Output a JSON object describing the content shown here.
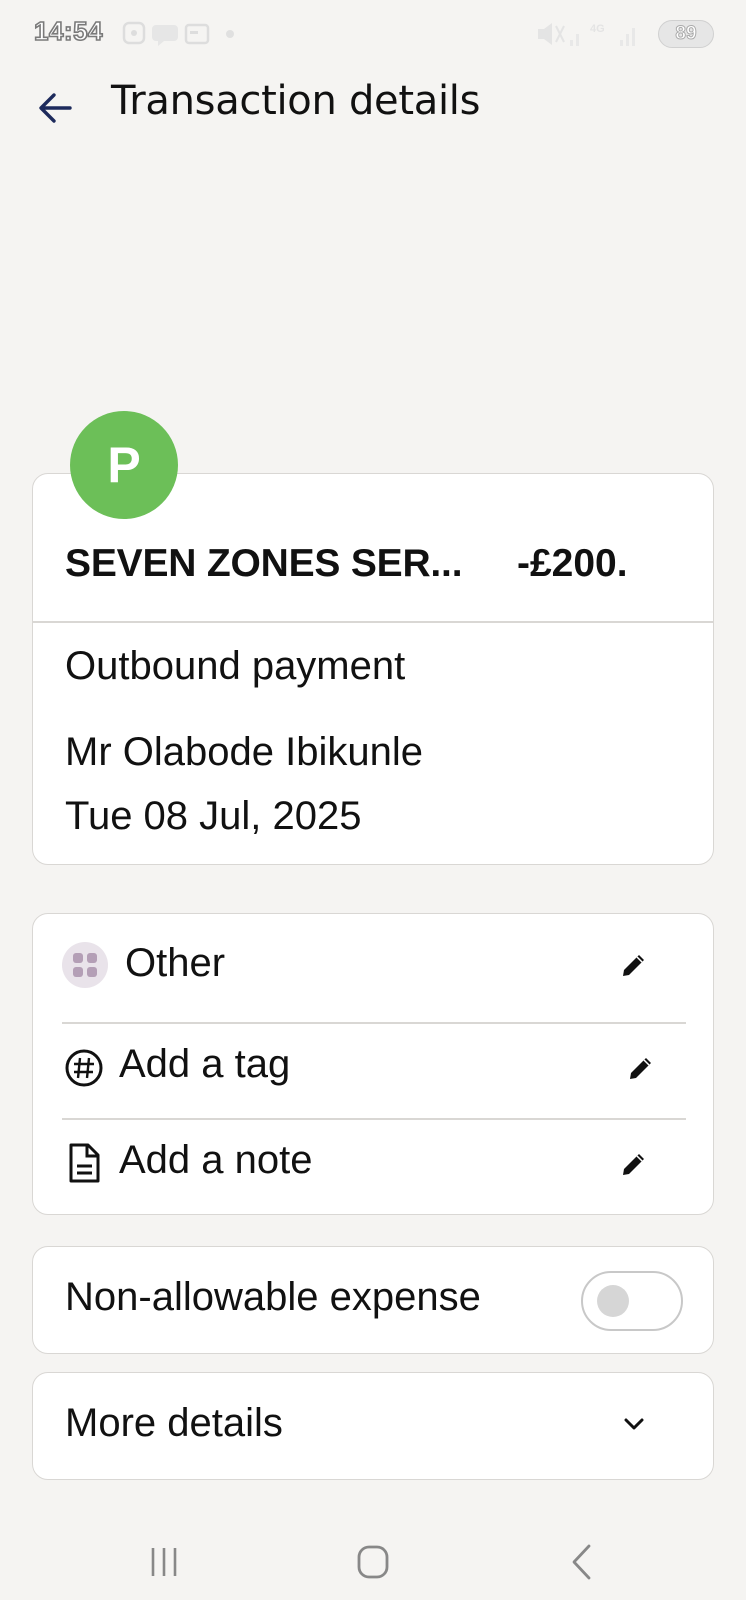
{
  "status_bar": {
    "time": "14:54",
    "battery": "89",
    "network": "4G"
  },
  "header": {
    "title": "Transaction details",
    "back_icon": "arrow-left-icon"
  },
  "transaction": {
    "avatar_letter": "P",
    "avatar_color": "#6cbf58",
    "merchant": "SEVEN ZONES SER...",
    "amount": "-£200.",
    "type": "Outbound payment",
    "payee": "Mr Olabode Ibikunle",
    "date": "Tue 08 Jul, 2025"
  },
  "actions": {
    "category_label": "Other",
    "category_icon": "grid-icon",
    "tag_label": "Add a tag",
    "tag_icon": "hashtag-icon",
    "note_label": "Add a note",
    "note_icon": "document-icon",
    "edit_icon": "pencil-icon"
  },
  "expense": {
    "label": "Non-allowable expense",
    "enabled": false
  },
  "more_details": {
    "label": "More details",
    "icon": "chevron-down-icon"
  },
  "nav": {
    "recents_icon": "recent-apps-icon",
    "home_icon": "home-icon",
    "back_icon": "back-icon"
  }
}
